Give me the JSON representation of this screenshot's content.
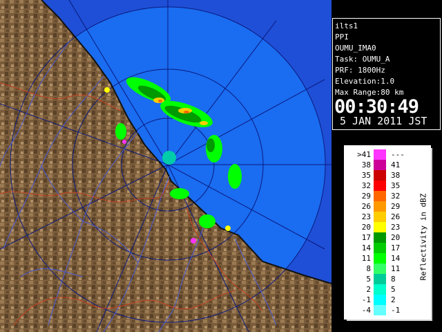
{
  "info": {
    "site": "ilts1",
    "scan_type": "PPI",
    "volume": "OUMU_IMA0",
    "task": "Task: OUMU_A",
    "prf": "PRF: 1800Hz",
    "elevation": "Elevation:1.0",
    "max_range": "Max Range:80 km",
    "time": "00:30:49",
    "date": "5 JAN 2011 JST"
  },
  "legend": {
    "title": "Reflectivity in dBZ",
    "rows": [
      {
        "lo": ">41",
        "hi": "---",
        "color": "#ff33ff"
      },
      {
        "lo": "38",
        "hi": "41",
        "color": "#cc0099"
      },
      {
        "lo": "35",
        "hi": "38",
        "color": "#cc0000"
      },
      {
        "lo": "32",
        "hi": "35",
        "color": "#ff0000"
      },
      {
        "lo": "29",
        "hi": "32",
        "color": "#ff6600"
      },
      {
        "lo": "26",
        "hi": "29",
        "color": "#ff9900"
      },
      {
        "lo": "23",
        "hi": "26",
        "color": "#ffcc00"
      },
      {
        "lo": "20",
        "hi": "23",
        "color": "#ffff00"
      },
      {
        "lo": "17",
        "hi": "20",
        "color": "#009900"
      },
      {
        "lo": "14",
        "hi": "17",
        "color": "#00cc00"
      },
      {
        "lo": "11",
        "hi": "14",
        "color": "#00ff00"
      },
      {
        "lo": "8",
        "hi": "11",
        "color": "#33ff66"
      },
      {
        "lo": "5",
        "hi": "8",
        "color": "#00cc99"
      },
      {
        "lo": "2",
        "hi": "5",
        "color": "#00ffcc"
      },
      {
        "lo": "-1",
        "hi": "2",
        "color": "#00ffff"
      },
      {
        "lo": "-4",
        "hi": "-1",
        "color": "#66ffff"
      }
    ]
  },
  "colors": {
    "sea_near": "#1a6cf0",
    "sea_far": "#1f4fd6",
    "land": "#7a5c3a",
    "range_rings": "#0a1a80",
    "rivers": "#4a5cd8",
    "boundaries": "#c84020"
  }
}
